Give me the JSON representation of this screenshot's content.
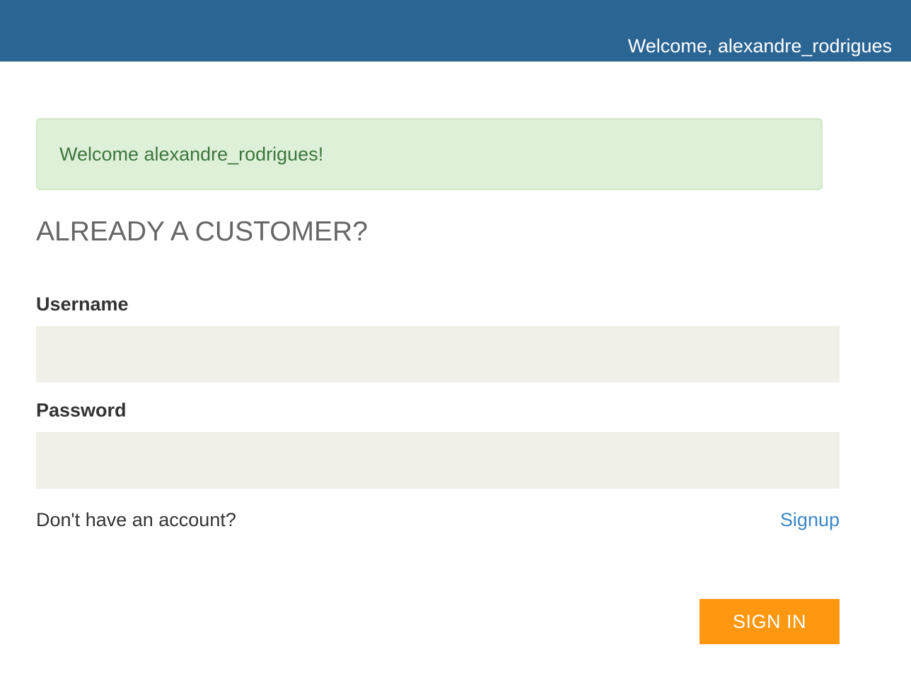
{
  "header": {
    "welcome_text": "Welcome, alexandre_rodrigues",
    "background_color": "#2b6594"
  },
  "alert": {
    "message": "Welcome alexandre_rodrigues!",
    "background_color": "#dff0d8",
    "text_color": "#3c763d"
  },
  "login": {
    "heading": "ALREADY A CUSTOMER?",
    "username_label": "Username",
    "username_value": "",
    "password_label": "Password",
    "password_value": "",
    "no_account_text": "Don't have an account?",
    "signup_link": "Signup",
    "signin_button": "SIGN IN",
    "accent_color": "#ff9810",
    "link_color": "#3a87c8"
  }
}
